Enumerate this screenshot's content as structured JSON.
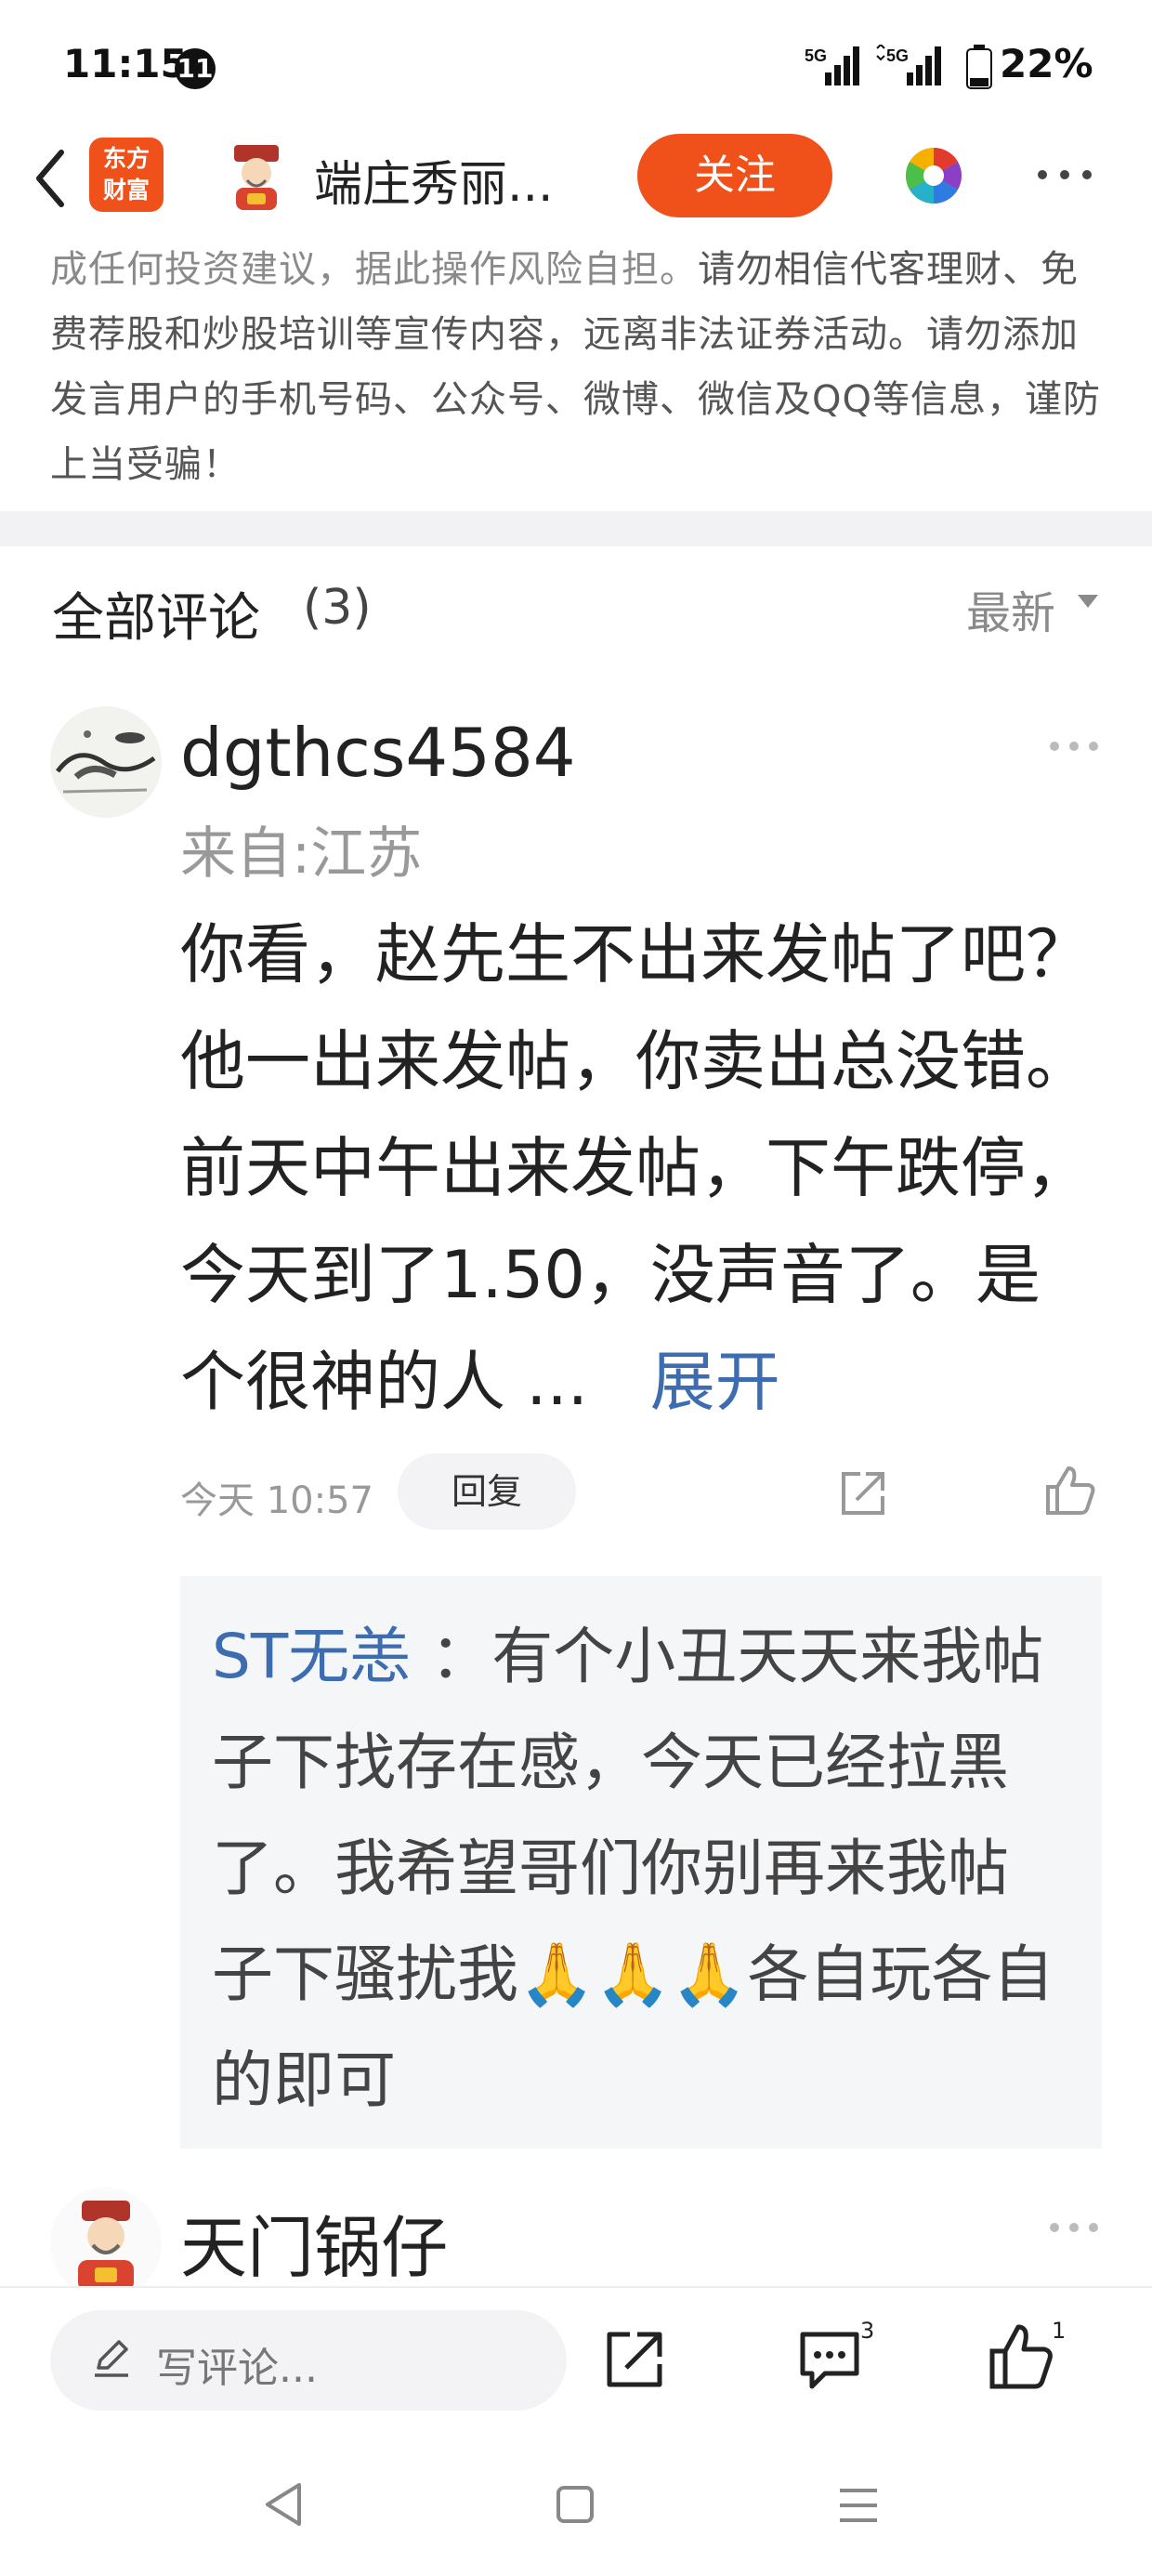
{
  "status_bar": {
    "time": "11:15",
    "notification_count": "11",
    "network_label_1": "5G",
    "network_label_2": "5G",
    "battery": "22%"
  },
  "header": {
    "app_logo_line1": "东方",
    "app_logo_line2": "财富",
    "title": "端庄秀丽...",
    "follow_label": "关注"
  },
  "disclaimer": {
    "gray_text": "成任何投资建议，据此操作风险自担。",
    "dark_text": "请勿相信代客理财、免费荐股和炒股培训等宣传内容，远离非法证券活动。请勿添加发言用户的手机号码、公众号、微博、微信及QQ等信息，谨防上当受骗！"
  },
  "comments_section": {
    "title": "全部评论",
    "count": "(3)",
    "sort_label": "最新"
  },
  "comment1": {
    "username": "dgthcs4584",
    "location": "来自:江苏",
    "text": "你看，赵先生不出来发帖了吧？他一出来发帖，你卖出总没错。前天中午出来发帖，下午跌停，今天到了1.50，没声音了。是个很神的人 ...",
    "expand_label": "展开",
    "time": "今天 10:57",
    "reply_label": "回复",
    "reply": {
      "author": "ST无恙",
      "text": "：有个小丑天天来我帖子下找存在感，今天已经拉黑了。我希望哥们你别再来我帖子下骚扰我🙏🙏🙏各自玩各自的即可"
    }
  },
  "comment2": {
    "username": "天门锅仔"
  },
  "bottom_bar": {
    "write_placeholder": "写评论...",
    "comment_count": "3",
    "like_count": "1"
  },
  "colors": {
    "accent": "#f0501a",
    "link": "#3d6cb0",
    "muted": "#999999"
  }
}
